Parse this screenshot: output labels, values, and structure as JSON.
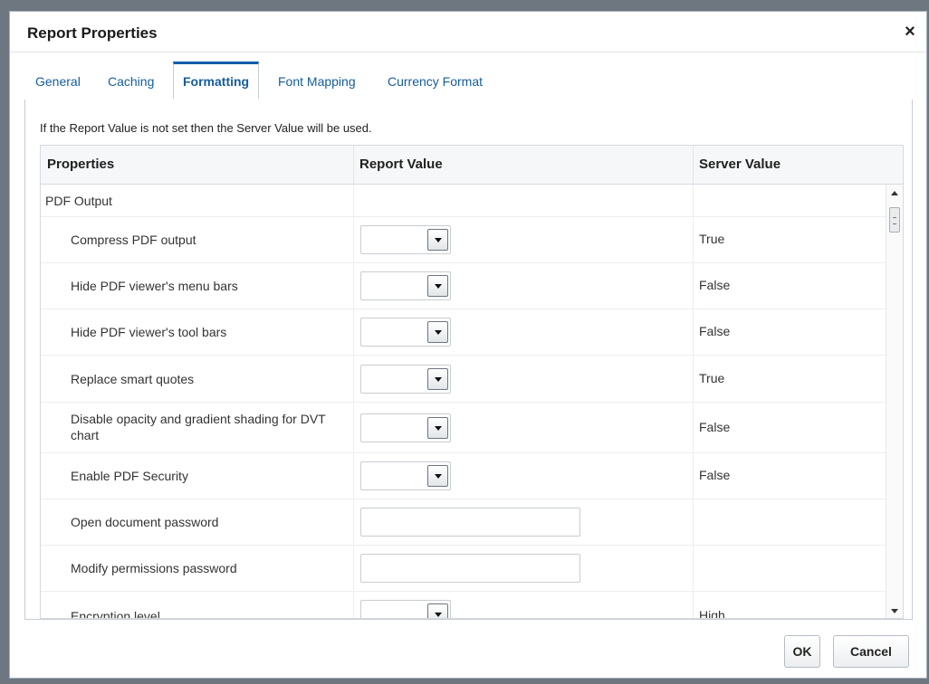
{
  "dialog": {
    "title": "Report Properties",
    "close_label": "×"
  },
  "tabs": [
    {
      "label": "General",
      "active": false
    },
    {
      "label": "Caching",
      "active": false
    },
    {
      "label": "Formatting",
      "active": true
    },
    {
      "label": "Font Mapping",
      "active": false
    },
    {
      "label": "Currency Format",
      "active": false
    }
  ],
  "info_text": "If the Report Value is not set then the Server Value will be used.",
  "table": {
    "columns": [
      "Properties",
      "Report Value",
      "Server Value"
    ],
    "rows": [
      {
        "property": "PDF Output",
        "control": "none",
        "server_value": ""
      },
      {
        "property": "Compress PDF output",
        "control": "select",
        "server_value": "True"
      },
      {
        "property": "Hide PDF viewer's menu bars",
        "control": "select",
        "server_value": "False"
      },
      {
        "property": "Hide PDF viewer's tool bars",
        "control": "select",
        "server_value": "False"
      },
      {
        "property": "Replace smart quotes",
        "control": "select",
        "server_value": "True"
      },
      {
        "property": "Disable opacity and gradient shading for DVT chart",
        "control": "select",
        "server_value": "False"
      },
      {
        "property": "Enable PDF Security",
        "control": "select",
        "server_value": "False"
      },
      {
        "property": "Open document password",
        "control": "text",
        "server_value": ""
      },
      {
        "property": "Modify permissions password",
        "control": "text",
        "server_value": ""
      },
      {
        "property": "Encryption level",
        "control": "select",
        "server_value": "High"
      }
    ]
  },
  "buttons": {
    "ok": "OK",
    "cancel": "Cancel"
  }
}
